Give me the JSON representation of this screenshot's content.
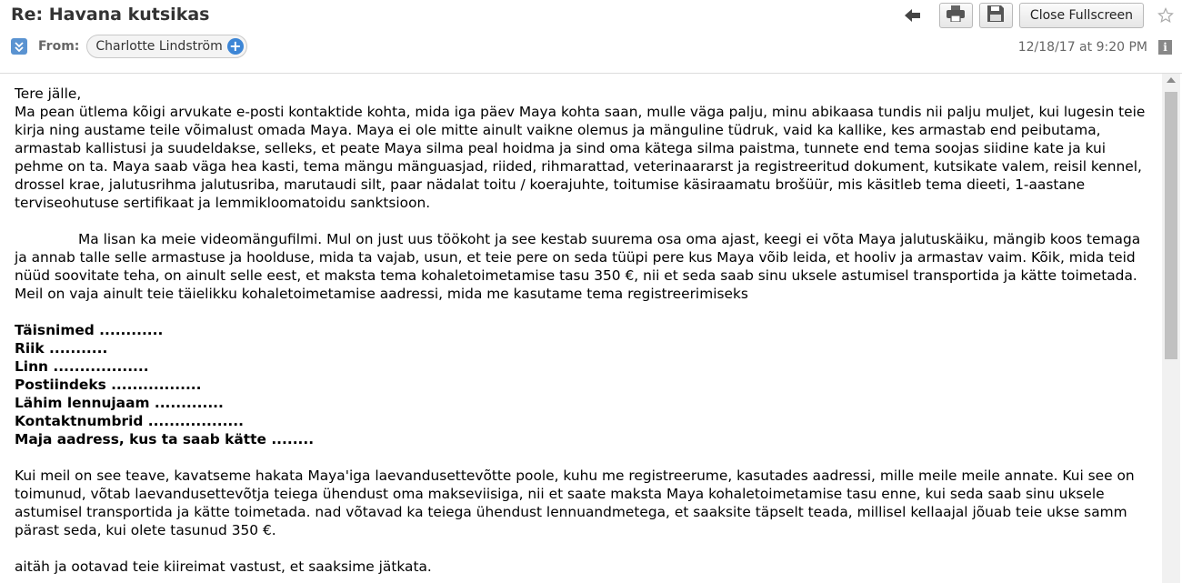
{
  "header": {
    "subject": "Re: Havana kutsikas",
    "from_label": "From:",
    "sender": "Charlotte Lindström",
    "date": "12/18/17 at 9:20 PM",
    "close_fullscreen_label": "Close Fullscreen",
    "icons": [
      "back-arrow-icon",
      "print-icon",
      "save-icon",
      "star-icon",
      "expand-icon",
      "add-contact-icon",
      "info-icon"
    ]
  },
  "message": {
    "greeting": "Tere jälle,",
    "p1": "Ma pean ütlema kõigi arvukate e-posti kontaktide kohta, mida iga päev Maya kohta saan, mulle väga palju, minu abikaasa tundis nii palju muljet, kui lugesin teie kirja ning austame teile võimalust omada Maya. Maya ei ole mitte ainult vaikne olemus ja mänguline tüdruk, vaid ka kallike, kes armastab end peibutama, armastab kallistusi ja suudeldakse, selleks, et peate Maya silma peal hoidma ja sind oma kätega silma paistma, tunnete end tema soojas siidine kate ja kui pehme on ta. Maya saab väga hea kasti, tema mängu mänguasjad, riided, rihmarattad, veterinaararst ja registreeritud dokument, kutsikate valem, reisil kennel, drossel krae, jalutusrihma jalutusriba, marutaudi silt, paar nädalat toitu / koerajuhte, toitumise käsiraamatu brošüür, mis käsitleb tema dieeti, 1-aastane terviseohutuse sertifikaat ja lemmikloomatoidu sanktsioon.",
    "p2": "Ma lisan ka meie videomängufilmi. Mul on just uus töökoht ja see kestab suurema osa oma ajast, keegi ei võta Maya jalutuskäiku, mängib koos temaga ja annab talle selle armastuse ja hoolduse, mida ta vajab, usun, et teie pere on seda tüüpi pere kus Maya võib leida, et hooliv ja armastav vaim. Kõik, mida teid nüüd soovitate teha, on ainult selle eest, et maksta tema kohaletoimetamise tasu 350 €, nii et seda saab sinu uksele astumisel transportida ja kätte toimetada. Meil on vaja ainult teie täielikku kohaletoimetamise aadressi, mida me kasutame tema registreerimiseks",
    "form_fields": [
      "Täisnimed ............",
      "Riik ...........",
      "Linn ..................",
      "Postiindeks .................",
      "Lähim lennujaam  .............",
      "Kontaktnumbrid  ..................",
      "Maja aadress, kus ta saab kätte  ........"
    ],
    "p3": "Kui meil on see teave, kavatseme hakata Maya'iga laevandusettevõtte poole, kuhu me registreerume, kasutades aadressi, mille meile meile annate. Kui see on toimunud, võtab laevandusettevõtja teiega ühendust oma makseviisiga, nii et saate maksta Maya kohaletoimetamise tasu enne, kui seda saab sinu uksele astumisel transportida ja kätte toimetada. nad võtavad ka teiega ühendust lennuandmetega, et saaksite täpselt teada, millisel kellaajal jõuab teie ukse samm pärast seda, kui olete tasunud 350 €.",
    "closing": "aitäh ja ootavad teie kiireimat vastust, et saaksime jätkata."
  }
}
